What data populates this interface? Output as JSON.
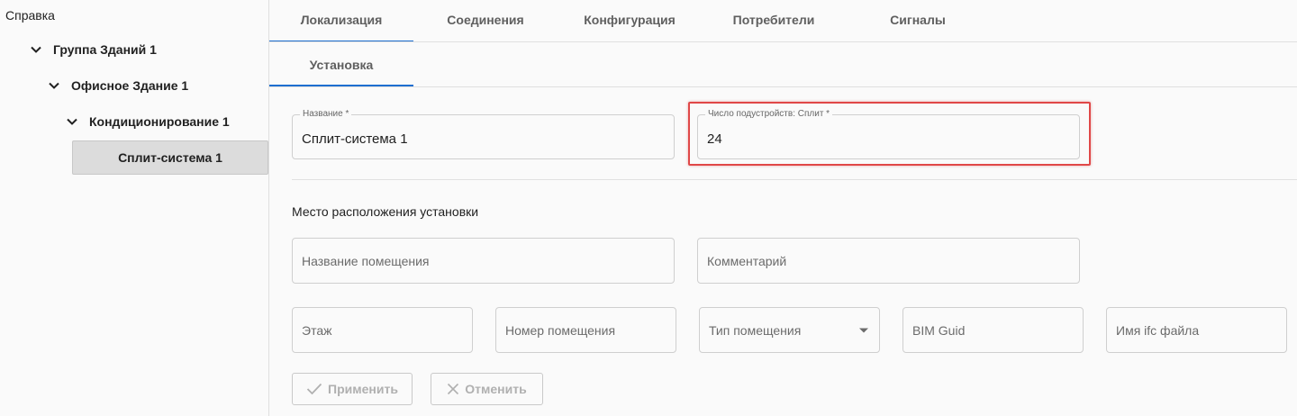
{
  "sidebar": {
    "title": "Справка",
    "tree": [
      {
        "label": "Группа Зданий 1"
      },
      {
        "label": "Офисное Здание 1"
      },
      {
        "label": "Кондиционирование 1"
      }
    ],
    "selected": "Сплит-система 1"
  },
  "tabs": {
    "row1": [
      "Локализация",
      "Соединения",
      "Конфигурация",
      "Потребители",
      "Сигналы"
    ],
    "row2": [
      "Установка"
    ],
    "active_row1": "Локализация",
    "active_row2": "Установка",
    "accent": "#1e6fd0"
  },
  "form": {
    "name": {
      "label": "Название *",
      "value": "Сплит-система 1"
    },
    "subdevices": {
      "label": "Число подустройств: Сплит *",
      "value": "24"
    },
    "location_title": "Место расположения установки",
    "room_name": {
      "placeholder": "Название помещения"
    },
    "comment": {
      "placeholder": "Комментарий"
    },
    "floor": {
      "placeholder": "Этаж"
    },
    "room_number": {
      "placeholder": "Номер помещения"
    },
    "room_type": {
      "placeholder": "Тип помещения"
    },
    "bim_guid": {
      "placeholder": "BIM Guid"
    },
    "ifc_file": {
      "placeholder": "Имя ifc файла"
    }
  },
  "actions": {
    "apply": "Применить",
    "cancel": "Отменить"
  },
  "highlight_color": "#e04848"
}
